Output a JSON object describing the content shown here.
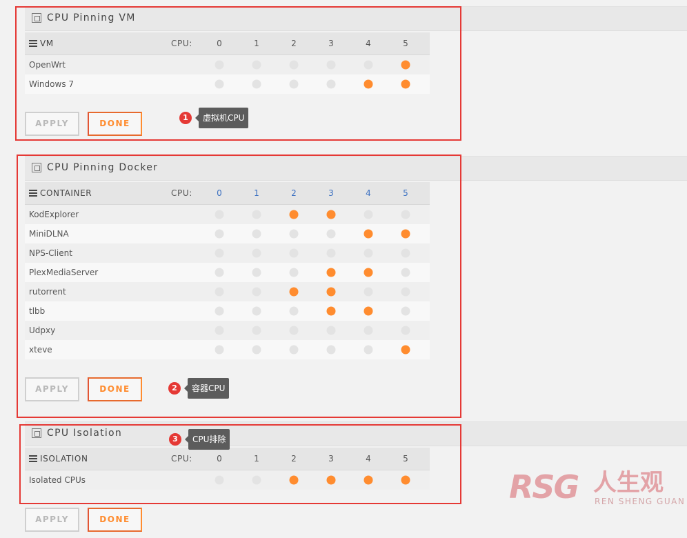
{
  "cpu_columns": [
    "0",
    "1",
    "2",
    "3",
    "4",
    "5"
  ],
  "vm_section": {
    "title": "CPU Pinning VM",
    "header_label": "VM",
    "cpu_label": "CPU:",
    "rows": [
      {
        "name": "OpenWrt",
        "cpus": [
          false,
          false,
          false,
          false,
          false,
          true
        ]
      },
      {
        "name": "Windows 7",
        "cpus": [
          false,
          false,
          false,
          false,
          true,
          true
        ]
      }
    ],
    "apply_label": "APPLY",
    "done_label": "DONE",
    "annotation_number": "1",
    "annotation_text": "虚拟机CPU"
  },
  "docker_section": {
    "title": "CPU Pinning Docker",
    "header_label": "CONTAINER",
    "cpu_label": "CPU:",
    "rows": [
      {
        "name": "KodExplorer",
        "cpus": [
          false,
          false,
          true,
          true,
          false,
          false
        ]
      },
      {
        "name": "MiniDLNA",
        "cpus": [
          false,
          false,
          false,
          false,
          true,
          true
        ]
      },
      {
        "name": "NPS-Client",
        "cpus": [
          false,
          false,
          false,
          false,
          false,
          false
        ]
      },
      {
        "name": "PlexMediaServer",
        "cpus": [
          false,
          false,
          false,
          true,
          true,
          false
        ]
      },
      {
        "name": "rutorrent",
        "cpus": [
          false,
          false,
          true,
          true,
          false,
          false
        ]
      },
      {
        "name": "tlbb",
        "cpus": [
          false,
          false,
          false,
          true,
          true,
          false
        ]
      },
      {
        "name": "Udpxy",
        "cpus": [
          false,
          false,
          false,
          false,
          false,
          false
        ]
      },
      {
        "name": "xteve",
        "cpus": [
          false,
          false,
          false,
          false,
          false,
          true
        ]
      }
    ],
    "apply_label": "APPLY",
    "done_label": "DONE",
    "annotation_number": "2",
    "annotation_text": "容器CPU"
  },
  "isolation_section": {
    "title": "CPU Isolation",
    "header_label": "ISOLATION",
    "cpu_label": "CPU:",
    "rows": [
      {
        "name": "Isolated CPUs",
        "cpus": [
          false,
          false,
          true,
          true,
          true,
          true
        ]
      }
    ],
    "apply_label": "APPLY",
    "done_label": "DONE",
    "annotation_number": "3",
    "annotation_text": "CPU排除"
  },
  "watermark": {
    "logo": "RSG",
    "cn_text": "人生观",
    "en_text": "REN SHENG GUAN"
  },
  "colors": {
    "pinned": "#ff8c2f",
    "unpinned": "#e3e3e3",
    "highlight_frame": "#e53935"
  }
}
